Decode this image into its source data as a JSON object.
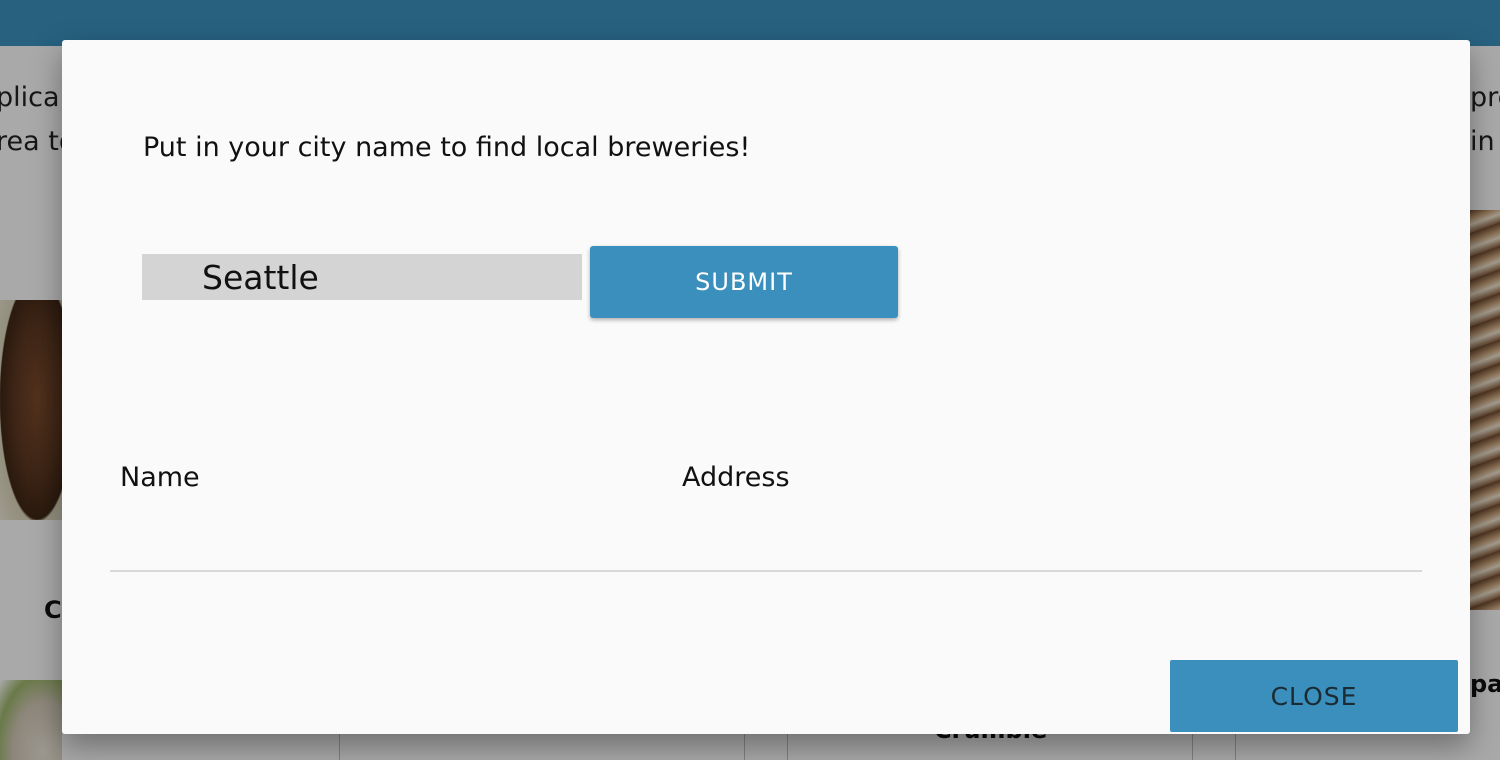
{
  "background": {
    "left_text_line1": "plica",
    "left_text_line2": "rea to",
    "right_text_line1": "pre",
    "right_text_line2": "in",
    "card_label_left": "C",
    "card_label_right": "pa",
    "card_label_middle": "Crumble"
  },
  "modal": {
    "prompt": "Put in your city name to find local breweries!",
    "city_input_value": "Seattle",
    "submit_label": "SUBMIT",
    "table": {
      "columns": [
        "Name",
        "Address"
      ],
      "rows": []
    },
    "close_label": "CLOSE"
  },
  "colors": {
    "accent": "#3a8fbc",
    "input_bg": "#d4d4d4",
    "modal_bg": "#fafafa"
  }
}
